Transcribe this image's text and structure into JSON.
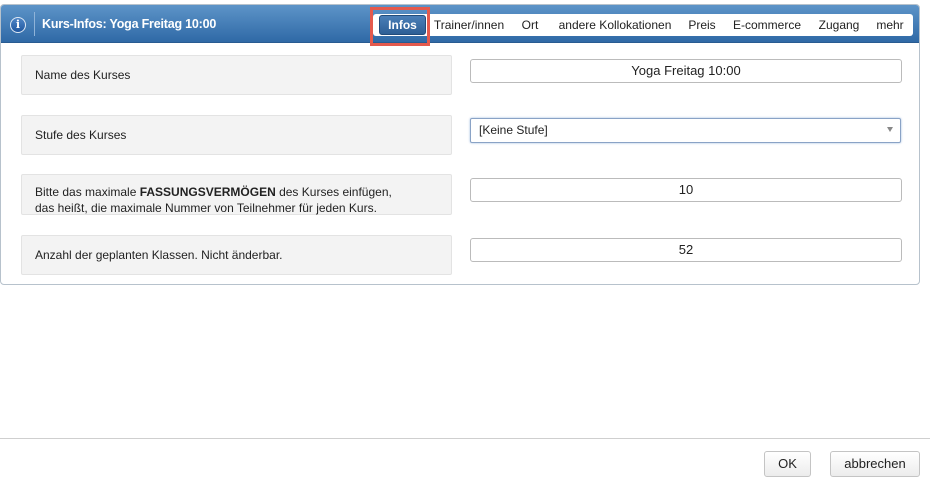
{
  "dialog": {
    "title": "Kurs-Infos: Yoga Freitag 10:00",
    "tabs": [
      {
        "label": "Infos",
        "active": true
      },
      {
        "label": "Trainer/innen"
      },
      {
        "label": "Ort"
      },
      {
        "label": "andere Kollokationen"
      },
      {
        "label": "Preis"
      },
      {
        "label": "E-commerce"
      },
      {
        "label": "Zugang"
      },
      {
        "label": "mehr"
      }
    ]
  },
  "form": {
    "name": {
      "label": "Name des Kurses",
      "value": "Yoga Freitag 10:00"
    },
    "level": {
      "label": "Stufe des Kurses",
      "value": "[Keine Stufe]"
    },
    "capacity": {
      "label_before": "Bitte das maximale ",
      "label_bold": "FASSUNGSVERMÖGEN",
      "label_after": " des Kurses einfügen,",
      "label_line2": "das heißt, die maximale Nummer von Teilnehmer für jeden Kurs.",
      "value": "10"
    },
    "classes": {
      "label": "Anzahl der geplanten Klassen. Nicht änderbar.",
      "value": "52"
    }
  },
  "footer": {
    "ok_label": "OK",
    "cancel_label": "abbrechen"
  },
  "colors": {
    "titlebar": "#3a74b0",
    "highlight": "#e45a4d"
  }
}
